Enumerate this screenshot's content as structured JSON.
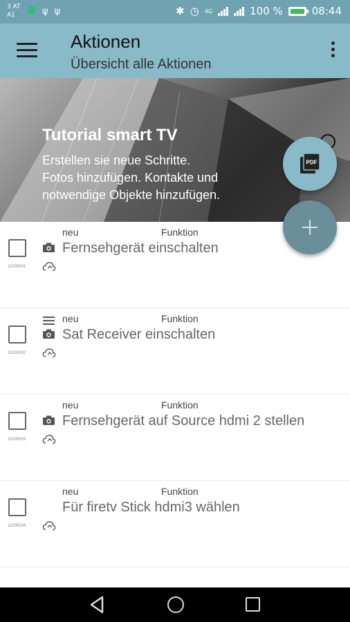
{
  "status_bar": {
    "carrier_line1": "3 AT",
    "carrier_line2": "A1",
    "battery": "100 %",
    "time": "08:44",
    "signal_label": "4G",
    "icons": [
      "whatsapp-icon",
      "usb-icon",
      "usb-icon",
      "bluetooth-icon",
      "alarm-icon",
      "signal-icon",
      "battery-icon"
    ]
  },
  "toolbar": {
    "title": "Aktionen",
    "subtitle": "Übersicht alle Aktionen",
    "icons": [
      "menu-icon",
      "overflow-menu-icon"
    ]
  },
  "banner": {
    "title": "Tutorial smart TV",
    "description": "Erstellen sie neue Schritte.\nFotos hinzufügen. Kontakte und\nnotwendige Objekte hinzufügen."
  },
  "fabs": {
    "pdf_label": "PDF",
    "icons": [
      "pdf-icon",
      "plus-icon"
    ]
  },
  "actions": [
    {
      "id": "11000001",
      "status": "neu",
      "type": "Funktion",
      "title": "Fernsehgerät einschalten",
      "has_photo": true,
      "has_drag": false
    },
    {
      "id": "11000002",
      "status": "neu",
      "type": "Funktion",
      "title": "Sat Receiver einschalten",
      "has_photo": true,
      "has_drag": true
    },
    {
      "id": "11000003",
      "status": "neu",
      "type": "Funktion",
      "title": "Fernsehgerät auf Source hdmi 2 stellen",
      "has_photo": true,
      "has_drag": false
    },
    {
      "id": "11000004",
      "status": "neu",
      "type": "Funktion",
      "title": "Für firetv Stick hdmi3 wählen",
      "has_photo": false,
      "has_drag": false
    }
  ],
  "colors": {
    "status_bar": "#6fa3b1",
    "toolbar": "#88bbc7",
    "fab_pdf": "#88bbc7",
    "fab_add": "#6a8f99"
  },
  "nav_bar": {
    "icons": [
      "back-icon",
      "home-icon",
      "recents-icon"
    ]
  }
}
